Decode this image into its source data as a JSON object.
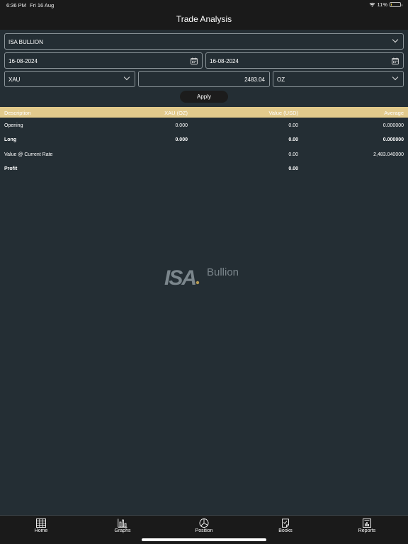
{
  "status_bar": {
    "time": "6:36 PM",
    "date": "Fri 16 Aug",
    "battery": "11%",
    "battery_level": 0.11
  },
  "header": {
    "title": "Trade Analysis"
  },
  "filters": {
    "account": "ISA BULLION",
    "from_date": "16-08-2024",
    "to_date": "16-08-2024",
    "metal": "XAU",
    "rate": "2483.04",
    "unit": "OZ",
    "apply_label": "Apply"
  },
  "table": {
    "columns": [
      "Description",
      "XAU (OZ)",
      "Value (USD)",
      "Average"
    ],
    "rows": [
      {
        "description": "Opening",
        "qty": "0.000",
        "value": "0.00",
        "average": "0.000000",
        "bold": false
      },
      {
        "description": "Long",
        "qty": "0.000",
        "value": "0.00",
        "average": "0.000000",
        "bold": true
      },
      {
        "description": "Value @ Current Rate",
        "qty": "",
        "value": "0.00",
        "average": "2,483.040000",
        "bold": false
      },
      {
        "description": "Profit",
        "qty": "",
        "value": "0.00",
        "average": "",
        "bold": true
      }
    ]
  },
  "watermark": {
    "brand": "ISA",
    "text": "Bullion"
  },
  "tabs": [
    {
      "label": "Home",
      "icon": "grid-icon"
    },
    {
      "label": "Graphs",
      "icon": "bar-chart-icon"
    },
    {
      "label": "Position",
      "icon": "pie-chart-icon"
    },
    {
      "label": "Books",
      "icon": "book-icon"
    },
    {
      "label": "Reports",
      "icon": "report-icon"
    }
  ],
  "colors": {
    "background": "#242e34",
    "header_bar": "#1a1a1a",
    "table_header": "#e2ca8c",
    "border": "#8d969b"
  }
}
